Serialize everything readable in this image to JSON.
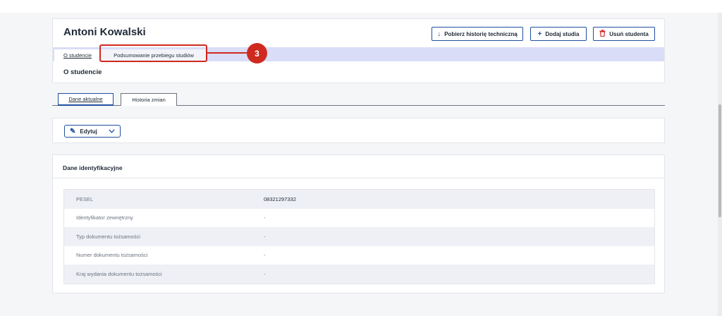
{
  "student": {
    "name": "Antoni Kowalski"
  },
  "header_actions": {
    "download_label": "Pobierz historię techniczną",
    "add_label": "Dodaj studia",
    "remove_label": "Usuń studenta"
  },
  "nav": {
    "tabs": [
      {
        "label": "O studencie"
      },
      {
        "label": "Podsumowanie przebiegu studiów"
      }
    ],
    "callout_number": "3"
  },
  "section": {
    "title": "O studencie"
  },
  "subtabs": [
    {
      "label": "Dane aktualne"
    },
    {
      "label": "Historia zmian"
    }
  ],
  "edit": {
    "label": "Edytuj"
  },
  "identification": {
    "title": "Dane identyfikacyjne",
    "rows": [
      {
        "key": "PESEL",
        "value": "08321297332"
      },
      {
        "key": "Identyfikator zewnętrzny",
        "value": "-"
      },
      {
        "key": "Typ dokumentu tożsamości",
        "value": "-"
      },
      {
        "key": "Numer dokumentu tożsamości",
        "value": "-"
      },
      {
        "key": "Kraj wydania dokumentu tożsamości",
        "value": "-"
      }
    ]
  },
  "colors": {
    "accent": "#1f4fa0",
    "callout": "#cf2a1f",
    "nav_strip": "#d9ddf7"
  }
}
